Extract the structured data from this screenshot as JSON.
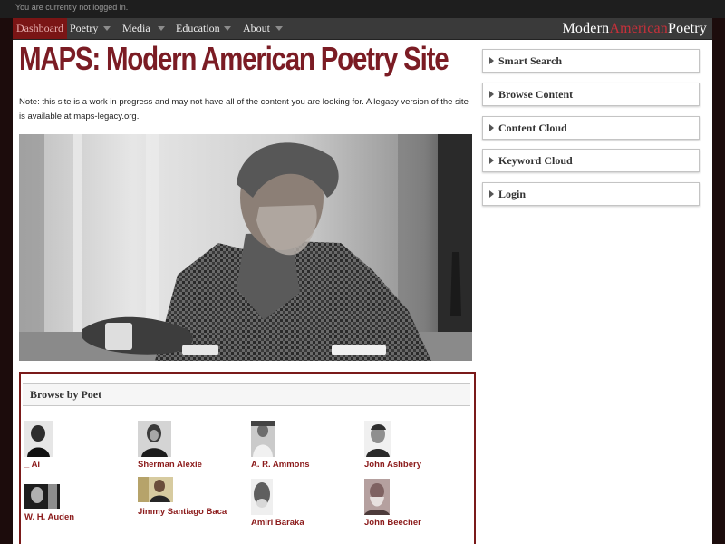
{
  "topbar": {
    "status": "You are currently not logged in."
  },
  "nav": {
    "items": [
      {
        "label": "Dashboard"
      },
      {
        "label": "Poetry"
      },
      {
        "label": "Media"
      },
      {
        "label": "Education"
      },
      {
        "label": "About"
      }
    ],
    "brand": {
      "left": "Modern",
      "mid": "American",
      "right": "Poetry"
    }
  },
  "main": {
    "title": "MAPS: Modern American Poetry Site",
    "note": "Note: this site is a work in progress and may not have all of the content you are looking for. A legacy version of the site is available at maps-legacy.org."
  },
  "browse": {
    "heading": "Browse by Poet",
    "poets": [
      {
        "name": "_ Ai"
      },
      {
        "name": "Sherman Alexie"
      },
      {
        "name": "A. R. Ammons"
      },
      {
        "name": "John Ashbery"
      },
      {
        "name": "W. H. Auden"
      },
      {
        "name": "Jimmy Santiago Baca"
      },
      {
        "name": "Amiri Baraka"
      },
      {
        "name": "John Beecher"
      }
    ]
  },
  "sidebar": {
    "items": [
      {
        "label": "Smart Search"
      },
      {
        "label": "Browse Content"
      },
      {
        "label": "Content Cloud"
      },
      {
        "label": "Keyword Cloud"
      },
      {
        "label": "Login"
      }
    ]
  },
  "colors": {
    "accent": "#7b1c24",
    "link": "#8b1a1a",
    "nav_bg": "#3a3a3a",
    "active_tab": "#7a1515"
  }
}
